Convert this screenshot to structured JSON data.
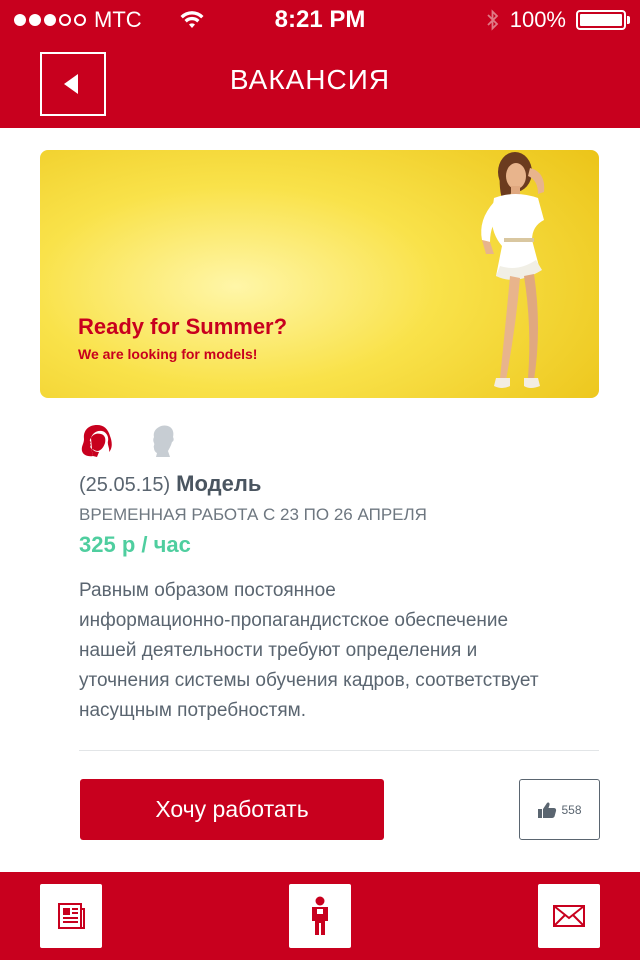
{
  "status_bar": {
    "carrier": "МТС",
    "time": "8:21 PM",
    "battery": "100%",
    "signal_bars": 3,
    "signal_max": 5
  },
  "nav": {
    "title": "ВАКАНСИЯ",
    "back_icon": "back-arrow-icon"
  },
  "banner": {
    "headline": "Ready for Summer?",
    "subline": "We are looking for models!"
  },
  "gender": {
    "female_color": "#c8001e",
    "male_color": "#c7cdd3"
  },
  "vacancy": {
    "date": "(25.05.15)",
    "name": "Модель",
    "subtitle": "ВРЕМЕННАЯ РАБОТА С 23 ПО 26 АПРЕЛЯ",
    "salary": "325 р / час",
    "description": [
      "Равным образом постоянное",
      "информационно-пропагандистское обеспечение",
      "нашей деятельности требуют определения и",
      "уточнения системы обучения кадров, соответствует",
      "насущным потребностям."
    ]
  },
  "actions": {
    "apply_label": "Хочу работать",
    "like_count": "558"
  },
  "tabbar": {
    "items": [
      {
        "icon": "newspaper-icon"
      },
      {
        "icon": "worker-icon"
      },
      {
        "icon": "envelope-icon"
      }
    ]
  },
  "colors": {
    "accent": "#c8001e",
    "salary": "#4fce9f",
    "text": "#5a6570"
  }
}
